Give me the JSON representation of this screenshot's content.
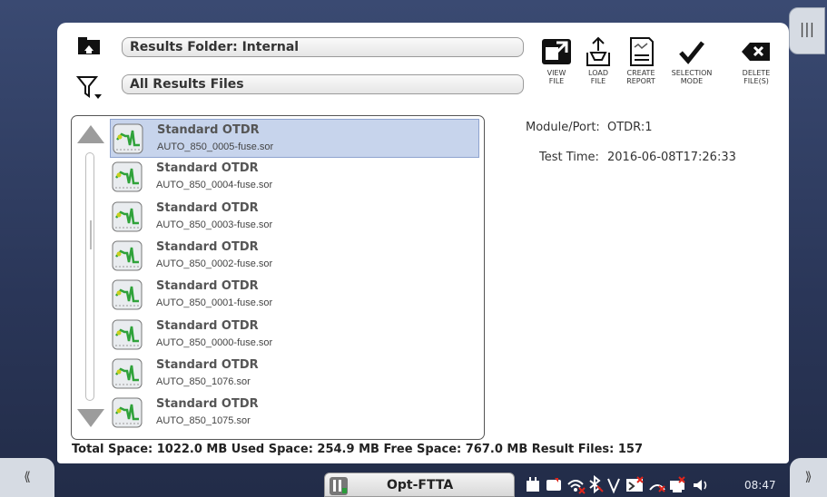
{
  "header": {
    "folder_label": "Results Folder: Internal",
    "filter_label": "All Results Files"
  },
  "toolbar": {
    "buttons": [
      {
        "label": "VIEW\nFILE"
      },
      {
        "label": "LOAD\nFILE"
      },
      {
        "label": "CREATE\nREPORT"
      },
      {
        "label": "SELECTION\nMODE"
      },
      {
        "label": "DELETE\nFILE(S)"
      }
    ]
  },
  "files": [
    {
      "type": "Standard OTDR",
      "name": "AUTO_850_0005-fuse.sor",
      "selected": true
    },
    {
      "type": "Standard OTDR",
      "name": "AUTO_850_0004-fuse.sor"
    },
    {
      "type": "Standard OTDR",
      "name": "AUTO_850_0003-fuse.sor"
    },
    {
      "type": "Standard OTDR",
      "name": "AUTO_850_0002-fuse.sor"
    },
    {
      "type": "Standard OTDR",
      "name": "AUTO_850_0001-fuse.sor"
    },
    {
      "type": "Standard OTDR",
      "name": "AUTO_850_0000-fuse.sor"
    },
    {
      "type": "Standard OTDR",
      "name": "AUTO_850_1076.sor"
    },
    {
      "type": "Standard OTDR",
      "name": "AUTO_850_1075.sor"
    }
  ],
  "details": {
    "module_port_label": "Module/Port:",
    "module_port_value": "OTDR:1",
    "test_time_label": "Test Time:",
    "test_time_value": "2016-06-08T17:26:33"
  },
  "footer": {
    "text": "Total Space: 1022.0 MB   Used Space: 254.9 MB   Free Space: 767.0 MB   Result Files: 157"
  },
  "taskbar": {
    "app_label": "Opt-FTTA",
    "clock": "08:47",
    "left_nav": "⟪",
    "right_nav": "⟫",
    "side_tab": "|||"
  },
  "colors": {
    "background": "#2b3857",
    "selected_row": "#c7d4ec",
    "accent_red": "#e0251b"
  }
}
